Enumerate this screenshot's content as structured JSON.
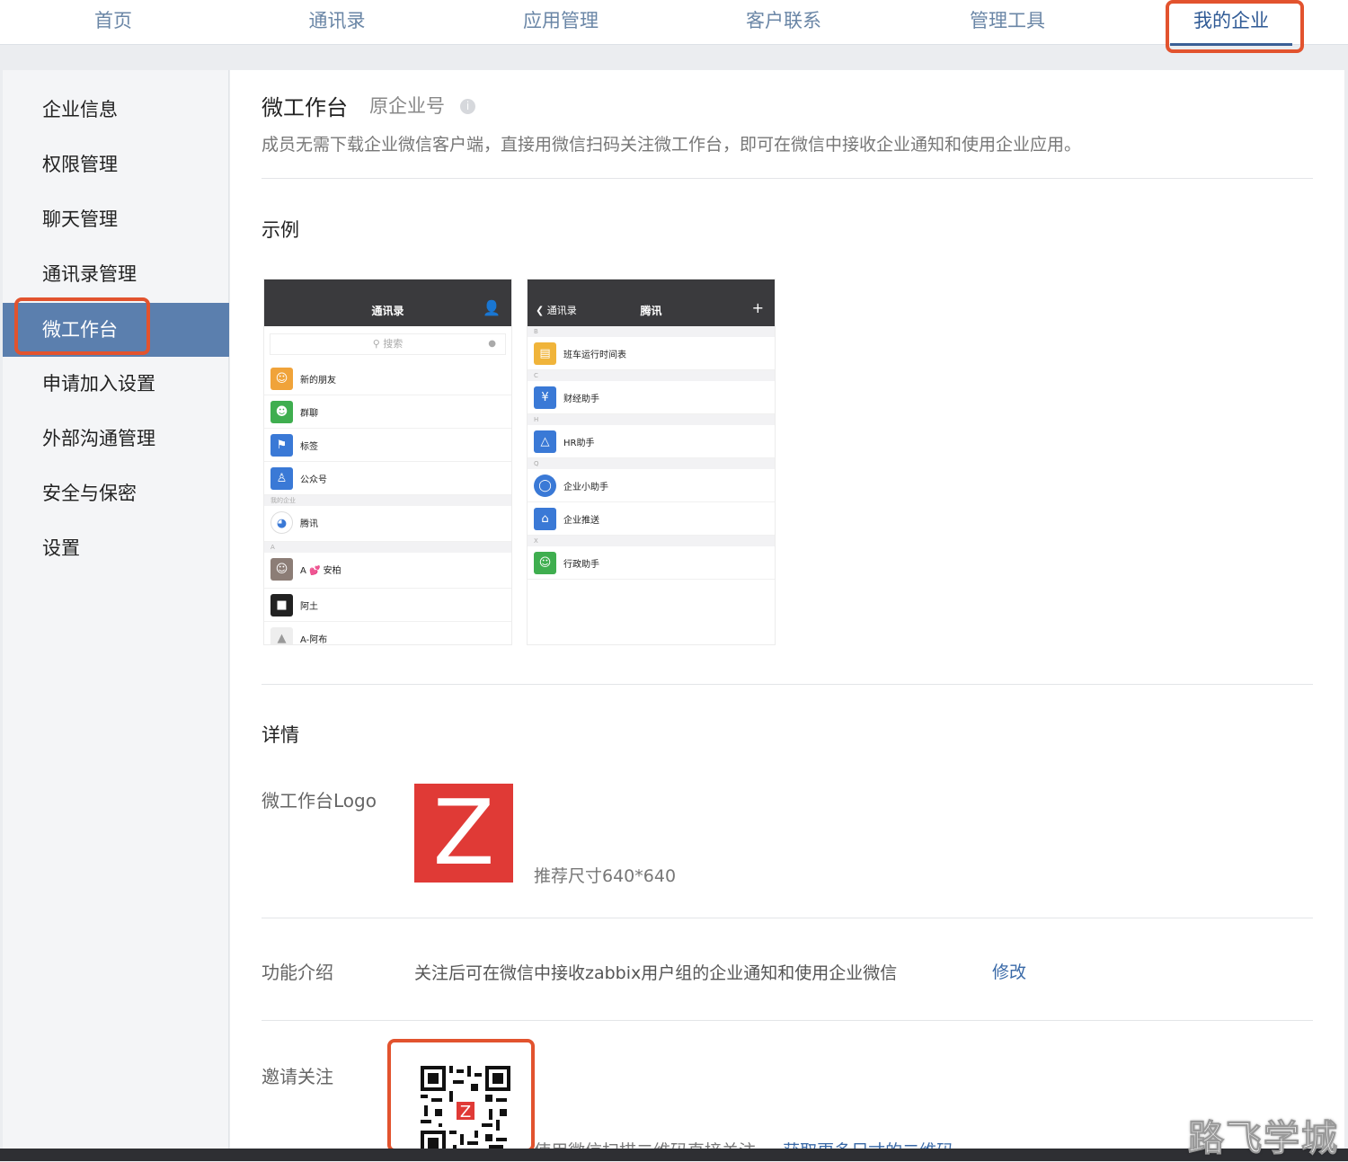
{
  "top_nav": {
    "tabs": [
      "首页",
      "通讯录",
      "应用管理",
      "客户联系",
      "管理工具",
      "我的企业"
    ],
    "active": "我的企业"
  },
  "sidebar": {
    "items": [
      "企业信息",
      "权限管理",
      "聊天管理",
      "通讯录管理",
      "微工作台",
      "申请加入设置",
      "外部沟通管理",
      "安全与保密",
      "设置"
    ],
    "active": "微工作台"
  },
  "main": {
    "title": "微工作台",
    "subtitle": "原企业号",
    "info_icon": "info-icon",
    "description": "成员无需下载企业微信客户端，直接用微信扫码关注微工作台，即可在微信中接收企业通知和使用企业应用。",
    "example_heading": "示例",
    "phone1": {
      "title": "通讯录",
      "search_placeholder": "搜索",
      "rows": [
        {
          "label": "新的朋友",
          "icon": "new-friend-icon",
          "color": "#f0a33a"
        },
        {
          "label": "群聊",
          "icon": "group-chat-icon",
          "color": "#3fae4f"
        },
        {
          "label": "标签",
          "icon": "tag-icon",
          "color": "#3a79d6"
        },
        {
          "label": "公众号",
          "icon": "official-account-icon",
          "color": "#3a79d6"
        }
      ],
      "section_my_company": "我的企业",
      "company_row": "腾讯",
      "section_a": "A",
      "contact_rows": [
        "A 💕 安柏",
        "阿土",
        "A-阿布"
      ]
    },
    "phone2": {
      "back": "通讯录",
      "title": "腾讯",
      "sections": [
        {
          "letter": "B",
          "rows": [
            {
              "label": "班车运行时间表",
              "color": "#f0b43a"
            }
          ]
        },
        {
          "letter": "C",
          "rows": [
            {
              "label": "财经助手",
              "color": "#3a79d6"
            }
          ]
        },
        {
          "letter": "H",
          "rows": [
            {
              "label": "HR助手",
              "color": "#3a79d6"
            }
          ]
        },
        {
          "letter": "Q",
          "rows": [
            {
              "label": "企业小助手",
              "color": "#3a79d6"
            },
            {
              "label": "企业推送",
              "color": "#3a79d6"
            }
          ]
        },
        {
          "letter": "X",
          "rows": [
            {
              "label": "行政助手",
              "color": "#3fae4f"
            }
          ]
        }
      ]
    },
    "details_heading": "详情",
    "logo_label": "微工作台Logo",
    "logo_letter": "Z",
    "logo_hint": "推荐尺寸640*640",
    "func_label": "功能介绍",
    "func_text": "关注后可在微信中接收zabbix用户组的企业通知和使用企业微信",
    "func_edit": "修改",
    "invite_label": "邀请关注",
    "qr_hint": "使用微信扫描二维码直接关注",
    "qr_more": "获取更多尺寸的二维码"
  },
  "watermark": "路飞学城",
  "colors": {
    "highlight": "#e2532e",
    "sidebar_active": "#5b7fae",
    "link": "#3a6aa8",
    "logo": "#e03a36"
  }
}
